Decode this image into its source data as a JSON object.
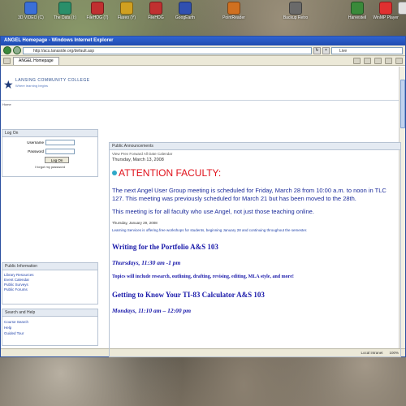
{
  "desktop": {
    "icons": [
      {
        "label": "3D VIDEO (C)",
        "color": "#3a6fd8"
      },
      {
        "label": "The Data (I:)",
        "color": "#2a8f6a"
      },
      {
        "label": "FileHOG (7)",
        "color": "#c03030"
      },
      {
        "label": "Flareo (Y)",
        "color": "#d0a020"
      },
      {
        "label": "FileHOG",
        "color": "#c03030"
      },
      {
        "label": "GoogEarth",
        "color": "#3050b0"
      },
      {
        "label": "PointReader",
        "color": "#d07020"
      },
      {
        "label": "Backup Retro",
        "color": "#6a6a6a"
      },
      {
        "label": "Harvestell",
        "color": "#3a8a3a"
      },
      {
        "label": "WinMP Player",
        "color": "#e03030"
      },
      {
        "label": "",
        "color": "#e0e0e0"
      }
    ]
  },
  "browser": {
    "title": "ANGEL Homepage - Windows Internet Explorer",
    "url": "http://acu.lanaside.org/default.asp",
    "search_placeholder": "Live",
    "tab_label": "ANGEL Homepage",
    "status_right": "Local intranet",
    "zoom": "100%"
  },
  "site": {
    "logo_text": "LANSING COMMUNITY COLLEGE",
    "logo_sub": "Where learning begins",
    "home_link": "Home"
  },
  "login": {
    "heading": "Log On",
    "username_label": "Username",
    "password_label": "Password",
    "button": "Log On",
    "forgot": "I forgot my password"
  },
  "public_info": {
    "heading": "Public Information",
    "items": [
      "Library Resources",
      "Event Calendar",
      "Public Surveys",
      "Public Forums"
    ]
  },
  "search_help": {
    "heading": "Search and Help",
    "items": [
      "Course Search",
      "Help",
      "Guided Tour"
    ]
  },
  "announcements": {
    "heading": "Public Announcements",
    "meta": "View Prev   Forward   All   Date Calendar",
    "date1": "Thursday, March 13, 2008",
    "title": "ATTENTION FACULTY:",
    "para1": "The next Angel User Group meeting is scheduled for Friday, March 28 from 10:00 a.m. to noon in TLC 127.  This meeting was previously scheduled for March 21 but has been moved to the 28th.",
    "para2": "This meeting is for all faculty who use Angel, not just those teaching online.",
    "date2": "Thursday, January 29, 2008",
    "small": "Learning Services is offering free workshops for students, beginning January 28 and continuing throughout the semester.",
    "workshop1_title": "Writing for the Portfolio   A&S 103",
    "workshop1_time": "Thursdays, 11:30 am -1 pm",
    "workshop1_topics": "Topics will include research, outlining, drafting, revising, editing, MLA style, and more!",
    "workshop2_title": "Getting to Know Your TI-83 Calculator   A&S 103",
    "workshop2_time": "Mondays, 11:10 am – 12:00 pm"
  }
}
